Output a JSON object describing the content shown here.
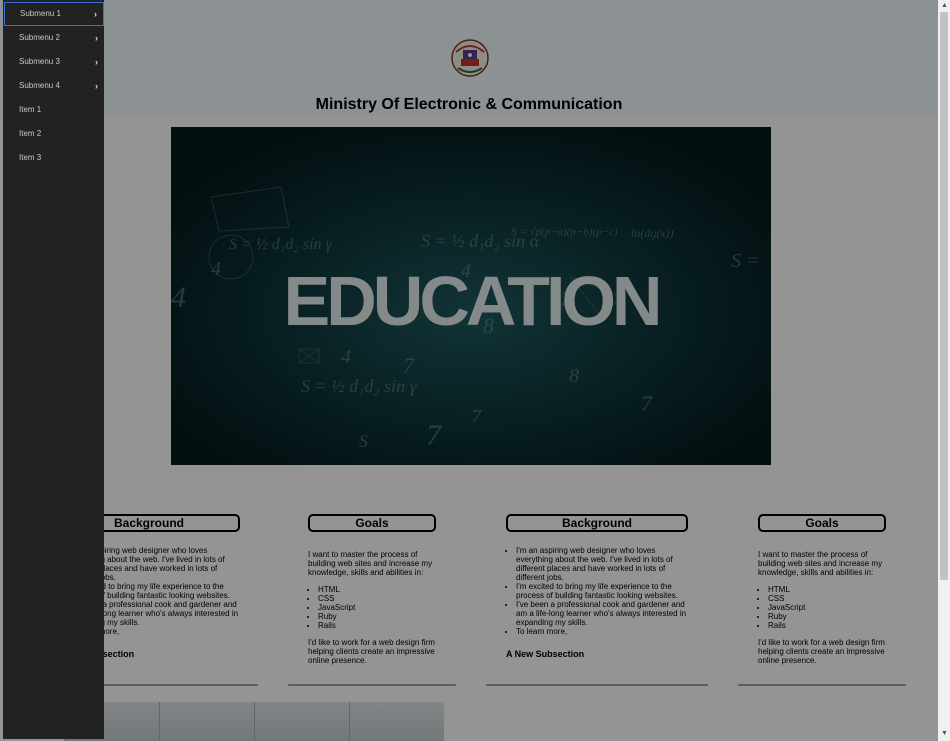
{
  "header": {
    "title": "Ministry Of Electronic & Communication",
    "logo_text": "भारत सरकार"
  },
  "hero": {
    "text": "EDUCATION"
  },
  "sections": [
    {
      "heading": "Background",
      "bullets": [
        "I'm an aspiring web designer who loves everything about the web. I've lived in lots of different places and have worked in lots of different jobs.",
        "I'm excited to bring my life experience to the process of building fantastic looking websites.",
        "I've been a professional cook and gardener and am a life-long learner who's always interested in expanding my skills.",
        "To learn more,"
      ],
      "subsection": "A New Subsection"
    },
    {
      "heading": "Goals",
      "intro": "I want to master the process of building web sites and increase my knowledge, skills and abilities in:",
      "list": [
        "HTML",
        "CSS",
        "JavaScript",
        "Ruby",
        "Rails"
      ],
      "outro": "I'd like to work for a web design firm helping clients create an impressive online presence."
    },
    {
      "heading": "Background",
      "bullets": [
        "I'm an aspiring web designer who loves everything about the web. I've lived in lots of different places and have worked in lots of different jobs.",
        "I'm excited to bring my life experience to the process of building fantastic looking websites.",
        "I've been a professional cook and gardener and am a life-long learner who's always interested in expanding my skills.",
        "To learn more,"
      ],
      "subsection": "A New Subsection"
    },
    {
      "heading": "Goals",
      "intro": "I want to master the process of building web sites and increase my knowledge, skills and abilities in:",
      "list": [
        "HTML",
        "CSS",
        "JavaScript",
        "Ruby",
        "Rails"
      ],
      "outro": "I'd like to work for a web design firm helping clients create an impressive online presence."
    }
  ],
  "sidebar": {
    "items": [
      {
        "label": "Submenu 1",
        "has_children": true,
        "active": true
      },
      {
        "label": "Submenu 2",
        "has_children": true
      },
      {
        "label": "Submenu 3",
        "has_children": true
      },
      {
        "label": "Submenu 4",
        "has_children": true
      },
      {
        "label": "Item 1"
      },
      {
        "label": "Item 2"
      },
      {
        "label": "Item 3"
      }
    ]
  },
  "colors": {
    "sidebar_bg": "#222222",
    "active_border": "#3b6fd6",
    "overlay": "rgba(0,0,0,0.42)"
  }
}
